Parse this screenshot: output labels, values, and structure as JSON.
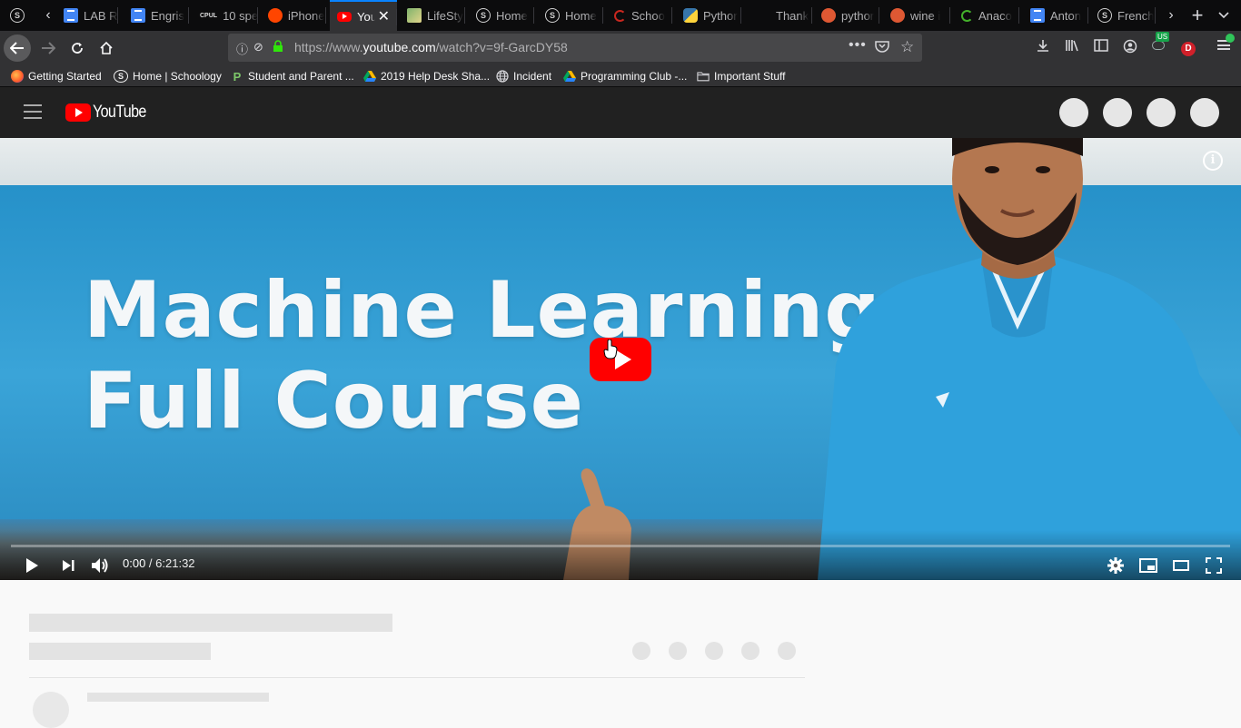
{
  "browser": {
    "tabs": [
      {
        "label": "LAB R",
        "favicon": "docs-icon"
      },
      {
        "label": "Engris",
        "favicon": "docs-icon"
      },
      {
        "label": "10 spe",
        "favicon": "cpu-icon",
        "favicon_text": "CPUL"
      },
      {
        "label": "iPhone",
        "favicon": "reddit-icon"
      },
      {
        "label": "You",
        "favicon": "youtube-icon",
        "active": true
      },
      {
        "label": "LifeSty",
        "favicon": "image-icon"
      },
      {
        "label": "Home",
        "favicon": "schoology-icon"
      },
      {
        "label": "Home",
        "favicon": "schoology-icon"
      },
      {
        "label": "Schoo",
        "favicon": "loading-icon"
      },
      {
        "label": "Pythor",
        "favicon": "python-icon"
      },
      {
        "label": "Thank",
        "favicon": "none"
      },
      {
        "label": "pythor",
        "favicon": "duckduckgo-icon"
      },
      {
        "label": "wine i",
        "favicon": "duckduckgo-icon"
      },
      {
        "label": "Anaco",
        "favicon": "anaconda-icon"
      },
      {
        "label": "Anton",
        "favicon": "docs-icon"
      },
      {
        "label": "French",
        "favicon": "schoology-icon"
      }
    ],
    "url": {
      "prefix": "https://www.",
      "domain": "youtube.com",
      "path": "/watch?v=9f-GarcDY58"
    },
    "badges": {
      "vpn_country": "US",
      "profile_letter": "D"
    },
    "bookmarks": [
      {
        "label": "Getting Started",
        "icon": "firefox-icon"
      },
      {
        "label": "Home | Schoology",
        "icon": "schoology-icon"
      },
      {
        "label": "Student and Parent ...",
        "icon": "parent-icon"
      },
      {
        "label": "2019 Help Desk Sha...",
        "icon": "drive-icon"
      },
      {
        "label": "Incident",
        "icon": "globe-icon"
      },
      {
        "label": "Programming Club -...",
        "icon": "drive-icon"
      },
      {
        "label": "Important Stuff",
        "icon": "folder-icon"
      }
    ]
  },
  "youtube": {
    "logo_text": "YouTube",
    "video": {
      "thumbnail_title_line1": "Machine Learning",
      "thumbnail_title_line2": "Full Course",
      "current_time": "0:00",
      "duration": "6:21:32",
      "progress": 0
    }
  },
  "colors": {
    "brand_red": "#ff0000",
    "yt_header": "#212121",
    "browser_chrome": "#323234",
    "active_tab_accent": "#0a84ff"
  }
}
